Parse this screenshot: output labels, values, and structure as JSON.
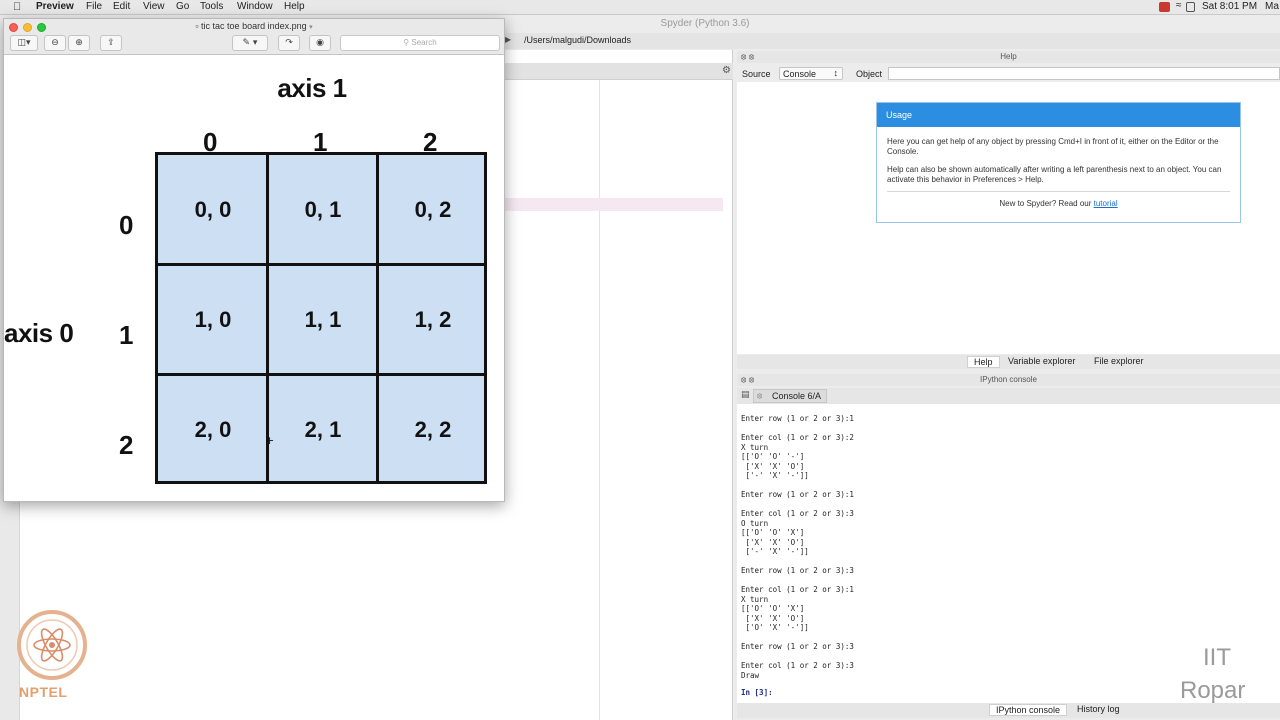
{
  "menubar": {
    "app_name": "Preview",
    "items": [
      "File",
      "Edit",
      "View",
      "Go",
      "Tools",
      "Window",
      "Help"
    ],
    "clock": "Sat 8:01 PM",
    "user": "Ma"
  },
  "spyder": {
    "title": "Spyder (Python 3.6)",
    "path": "/Users/malgudi/Downloads",
    "help_pane": {
      "title": "Help",
      "source_label": "Source",
      "source_value": "Console",
      "object_label": "Object",
      "usage": {
        "heading": "Usage",
        "p1": "Here you can get help of any object by pressing Cmd+I in front of it, either on the Editor or the Console.",
        "p2": "Help can also be shown automatically after writing a left parenthesis next to an object. You can activate this behavior in Preferences > Help.",
        "footer_text": "New to Spyder? Read our ",
        "footer_link": "tutorial"
      },
      "tabs": [
        "Help",
        "Variable explorer",
        "File explorer"
      ]
    },
    "console_pane": {
      "title": "IPython console",
      "tab_label": "Console 6/A",
      "output": "Enter row (1 or 2 or 3):1\n\nEnter col (1 or 2 or 3):2\nX turn\n[['O' 'O' '-']\n ['X' 'X' 'O']\n ['-' 'X' '-']]\n\nEnter row (1 or 2 or 3):1\n\nEnter col (1 or 2 or 3):3\nO turn\n[['O' 'O' 'X']\n ['X' 'X' 'O']\n ['-' 'X' '-']]\n\nEnter row (1 or 2 or 3):3\n\nEnter col (1 or 2 or 3):1\nX turn\n[['O' 'O' 'X']\n ['X' 'X' 'O']\n ['O' 'X' '-']]\n\nEnter row (1 or 2 or 3):3\n\nEnter col (1 or 2 or 3):3\nDraw",
      "prompt": "In [3]:",
      "tabs": [
        "IPython console",
        "History log"
      ]
    }
  },
  "preview": {
    "title": "tic tac toe board index.png",
    "search_placeholder": "Search",
    "image": {
      "axis1_label": "axis 1",
      "axis0_label": "axis 0",
      "col_labels": [
        "0",
        "1",
        "2"
      ],
      "row_labels": [
        "0",
        "1",
        "2"
      ],
      "cells": [
        [
          "0, 0",
          "0, 1",
          "0, 2"
        ],
        [
          "1, 0",
          "1, 1",
          "1, 2"
        ],
        [
          "2, 0",
          "2, 1",
          "2, 2"
        ]
      ],
      "cell_color": "#cddff2"
    }
  },
  "watermark": {
    "nptel": "NPTEL",
    "iit": "IIT",
    "ropar": "Ropar"
  },
  "colors": {
    "usage_header": "#2b8ee0",
    "nptel_orange": "#e0a070"
  }
}
